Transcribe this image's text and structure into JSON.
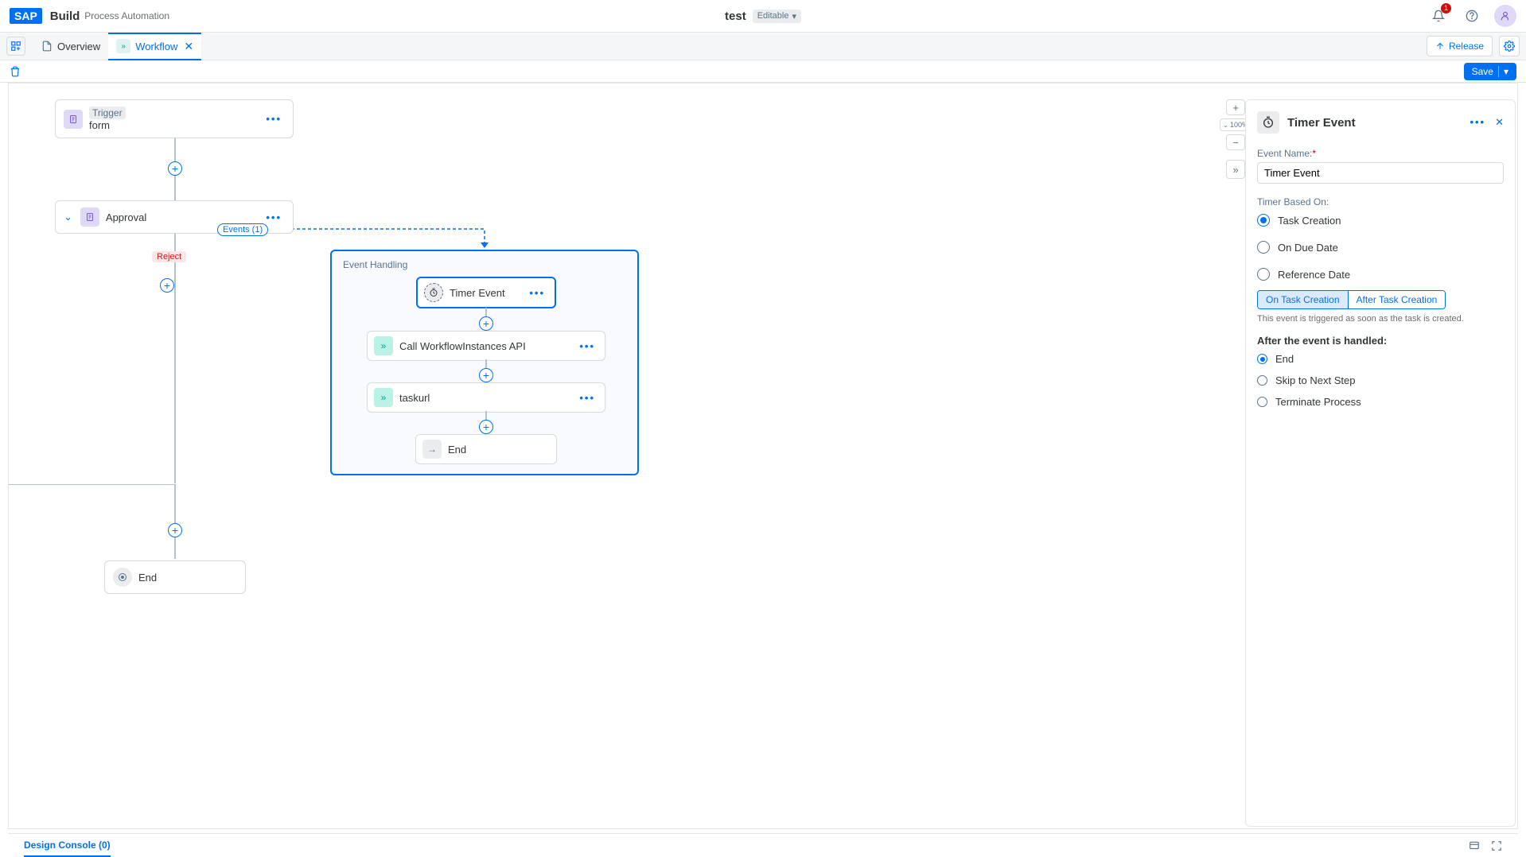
{
  "header": {
    "logo": "SAP",
    "build": "Build",
    "product": "Process Automation",
    "project": "test",
    "status": "Editable",
    "notifications": "1"
  },
  "tabs": {
    "overview": "Overview",
    "workflow": "Workflow",
    "release": "Release"
  },
  "toolbar": {
    "save": "Save"
  },
  "zoom": {
    "pct": "100%"
  },
  "nodes": {
    "trigger": {
      "title": "Trigger",
      "sub": "form"
    },
    "approval": "Approval",
    "reject": "Reject",
    "events": "Events (1)",
    "eh_title": "Event Handling",
    "timer": "Timer Event",
    "call_api": "Call WorkflowInstances API",
    "taskurl": "taskurl",
    "end_inner": "End",
    "end": "End"
  },
  "panel": {
    "title": "Timer Event",
    "event_name_label": "Event Name:",
    "event_name_value": "Timer Event",
    "timer_based_label": "Timer Based On:",
    "opt_task_creation": "Task Creation",
    "opt_due_date": "On Due Date",
    "opt_ref_date": "Reference Date",
    "seg_on": "On Task Creation",
    "seg_after": "After Task Creation",
    "hint": "This event is triggered as soon as the task is created.",
    "after_label": "After the event is handled:",
    "opt_end": "End",
    "opt_skip": "Skip to Next Step",
    "opt_terminate": "Terminate Process"
  },
  "footer": {
    "console": "Design Console (0)"
  }
}
